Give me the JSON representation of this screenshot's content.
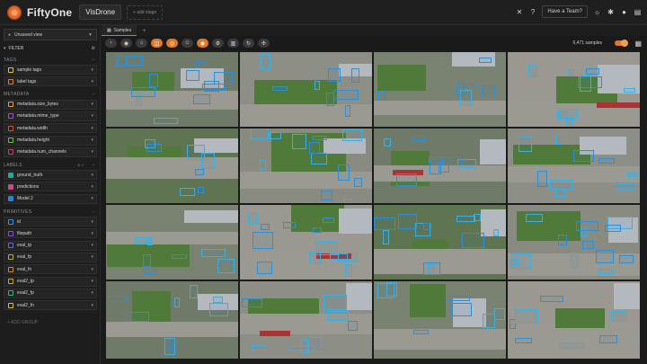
{
  "app": {
    "name": "FiftyOne",
    "dataset": "VisDrone",
    "add_stage": "+ add stage",
    "team_button": "Have a Team?"
  },
  "sidebar": {
    "view_select": "Unsaved view",
    "filter_label": "FILTER",
    "sections": {
      "tags": "TAGS",
      "metadata": "METADATA",
      "labels": "LABELS",
      "primitives": "PRIMITIVES"
    },
    "tags": [
      "sample tags",
      "label tags"
    ],
    "metadata": [
      "metadata.size_bytes",
      "metadata.mime_type",
      "metadata.width",
      "metadata.height",
      "metadata.num_channels"
    ],
    "labels_count": "3 ✓",
    "labels": [
      "ground_truth",
      "predictions",
      "Model 2"
    ],
    "primitives": [
      "id",
      "filepath",
      "eval_tp",
      "eval_fp",
      "eval_fn",
      "eval2_tp",
      "eval2_fp",
      "eval2_fn"
    ],
    "add_group": "+ ADD GROUP",
    "colors": {
      "tags": [
        "#d6c35a",
        "#e07b3a"
      ],
      "metadata": [
        "#e6a02f",
        "#a24fc9",
        "#d2542f",
        "#6dbf4c",
        "#c63f7a"
      ],
      "labels": [
        "#27a69a",
        "#c94c8a",
        "#2f7fd6"
      ],
      "primitives": [
        "#3a8fe0",
        "#8a4fd6",
        "#5f6dd8",
        "#a9b83a",
        "#d08540",
        "#c9a83a",
        "#3ab08a",
        "#d6bf4f"
      ]
    }
  },
  "tabs": {
    "samples": "Samples",
    "add": "+"
  },
  "toolbar": {
    "samples_count": "6,471 samples",
    "accent": "#e57722"
  },
  "grid": {
    "rows": 4,
    "cols": 4
  }
}
